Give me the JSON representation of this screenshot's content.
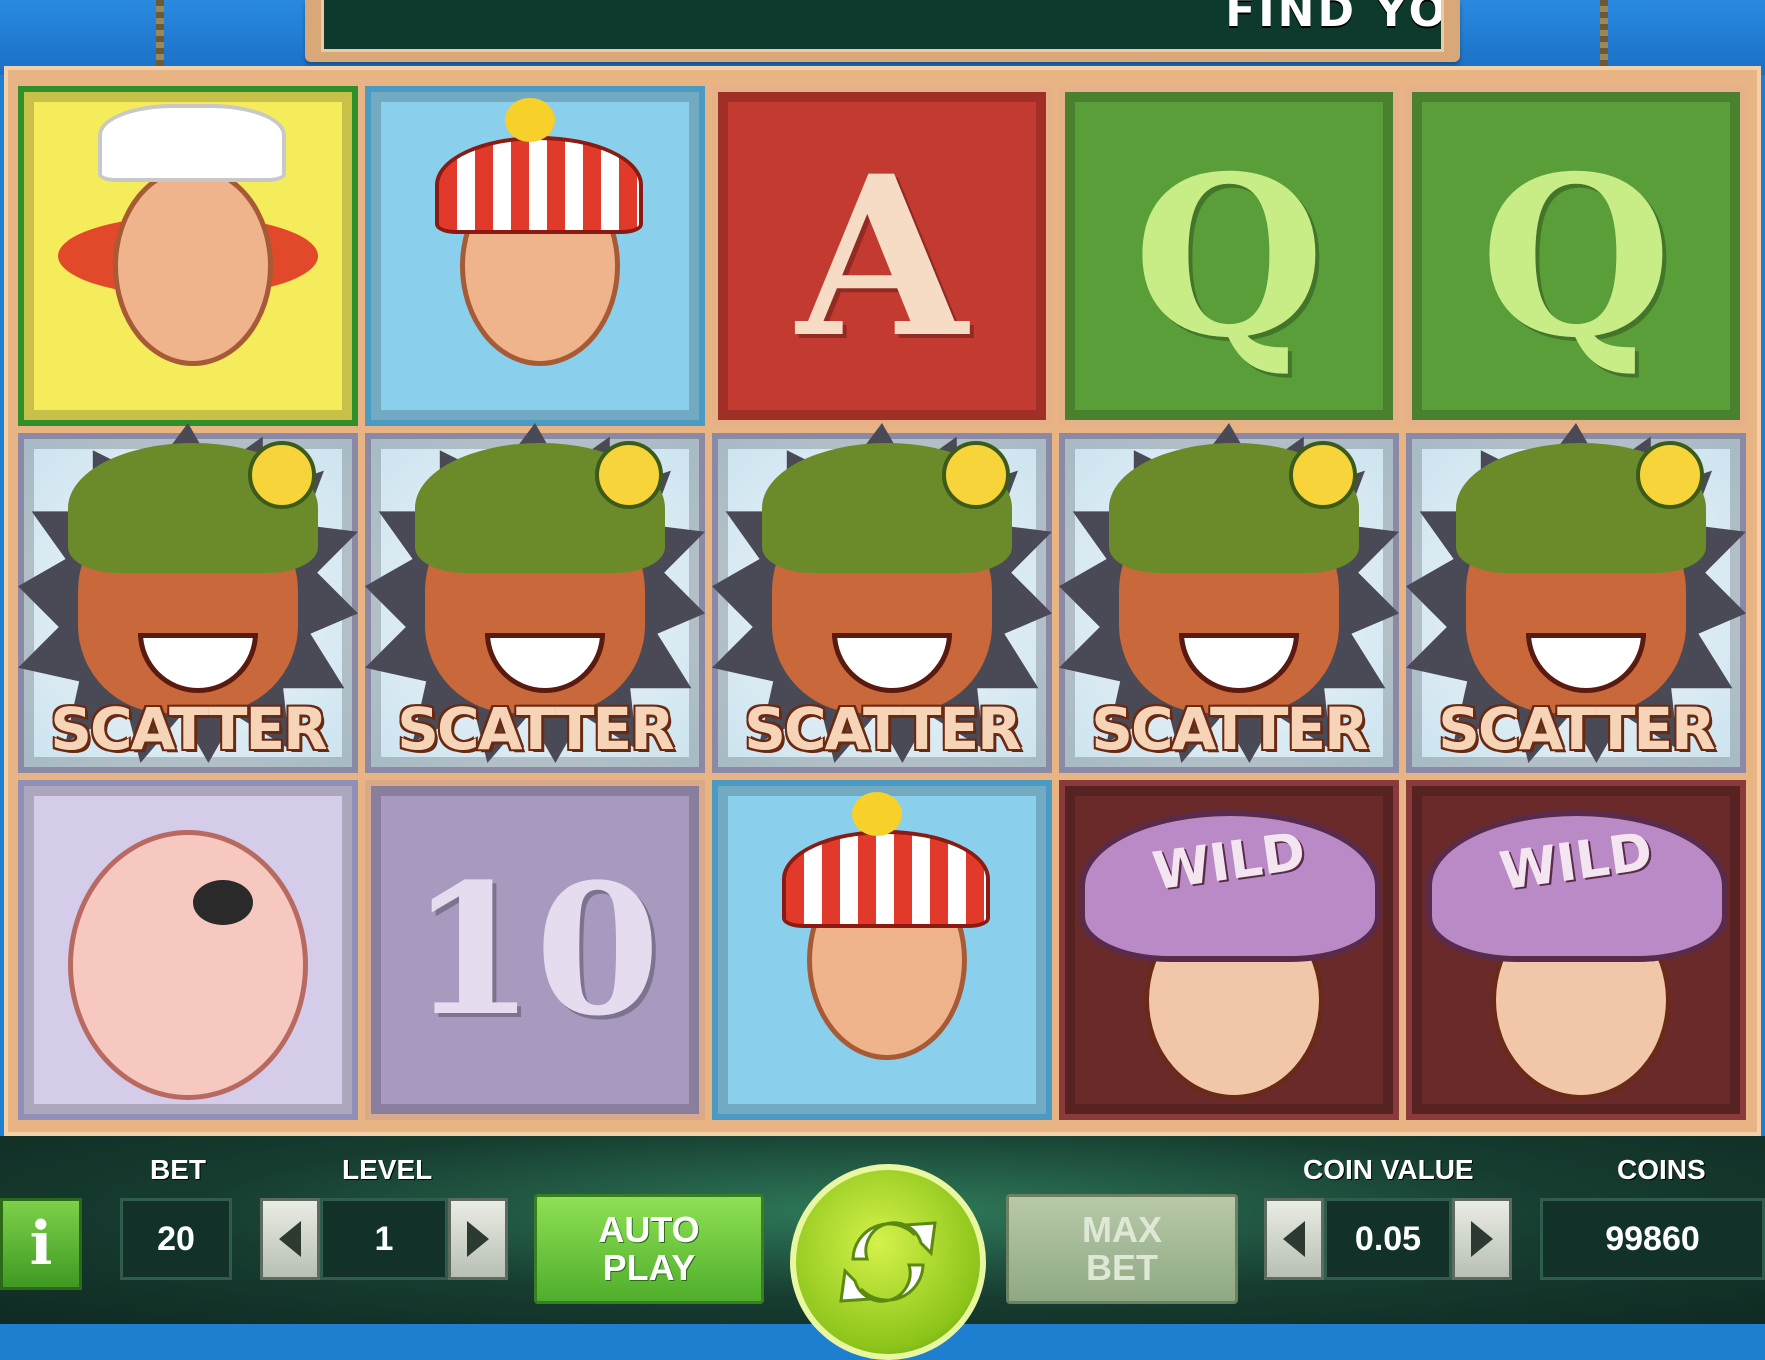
{
  "banner": {
    "text": "FIND YO"
  },
  "colors": {
    "sky": "#1e7fd0",
    "frame": "#e9b484",
    "bar_bg": "#163c30",
    "auto_play_button": "#6cc83e",
    "max_bet_button": "#a5b899",
    "spin_button": "#a8d82a",
    "scatter_label": "#f6d4b8"
  },
  "reels": [
    [
      {
        "symbol": "nurse-pirate",
        "frame_color": "#2f8f2a",
        "bg_color": "#f4ec5a"
      },
      {
        "symbol": "scatter",
        "label": "SCATTER"
      },
      {
        "symbol": "eyepatch-pirate",
        "frame_color": "#8f8fb8",
        "bg_color": "#d4cce8"
      }
    ],
    [
      {
        "symbol": "duck-hat-pirate",
        "frame_color": "#4a9ac4",
        "bg_color": "#8ad0ec"
      },
      {
        "symbol": "scatter",
        "label": "SCATTER"
      },
      {
        "symbol": "letter",
        "text": "10",
        "frame_color": "#d8a98a",
        "bg_color": "#a89abe",
        "glyph_color": "#e6dcf0"
      }
    ],
    [
      {
        "symbol": "letter",
        "text": "A",
        "frame_color": "#e6b089",
        "bg_color": "#c23a30",
        "glyph_color": "#f6dcc4"
      },
      {
        "symbol": "scatter",
        "label": "SCATTER"
      },
      {
        "symbol": "duck-hat-pirate",
        "frame_color": "#4a9ac4",
        "bg_color": "#8ad0ec"
      }
    ],
    [
      {
        "symbol": "letter",
        "text": "Q",
        "frame_color": "#e6b089",
        "bg_color": "#5a9e3a",
        "glyph_color": "#c8ec86"
      },
      {
        "symbol": "scatter",
        "label": "SCATTER"
      },
      {
        "symbol": "wild-captain",
        "label": "WILD",
        "frame_color": "#8a3a3a",
        "bg_color": "#6a2a2a"
      }
    ],
    [
      {
        "symbol": "letter",
        "text": "Q",
        "frame_color": "#e6b089",
        "bg_color": "#5a9e3a",
        "glyph_color": "#c8ec86"
      },
      {
        "symbol": "scatter",
        "label": "SCATTER"
      },
      {
        "symbol": "wild-captain",
        "label": "WILD",
        "frame_color": "#8a3a3a",
        "bg_color": "#6a2a2a"
      }
    ]
  ],
  "controls": {
    "info_icon": "i",
    "bet_label": "BET",
    "bet_value": "20",
    "level_label": "LEVEL",
    "level_value": "1",
    "auto_play_line1": "AUTO",
    "auto_play_line2": "PLAY",
    "max_bet_line1": "MAX",
    "max_bet_line2": "BET",
    "coin_value_label": "COIN VALUE",
    "coin_value": "0.05",
    "coins_label": "COINS",
    "coins_value": "99860"
  }
}
